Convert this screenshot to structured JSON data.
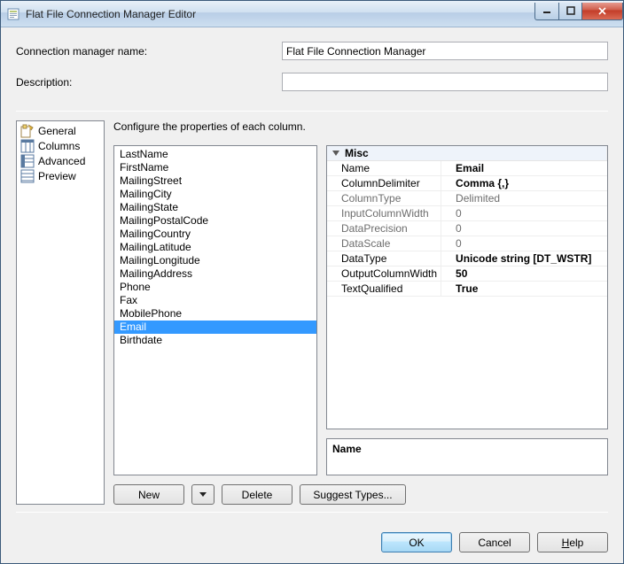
{
  "window": {
    "title": "Flat File Connection Manager Editor"
  },
  "fields": {
    "name_label": "Connection manager name:",
    "name_value": "Flat File Connection Manager",
    "desc_label": "Description:",
    "desc_value": ""
  },
  "nav": {
    "items": [
      {
        "label": "General"
      },
      {
        "label": "Columns"
      },
      {
        "label": "Advanced"
      },
      {
        "label": "Preview"
      }
    ]
  },
  "instruction": "Configure the properties of each column.",
  "columns": [
    "LastName",
    "FirstName",
    "MailingStreet",
    "MailingCity",
    "MailingState",
    "MailingPostalCode",
    "MailingCountry",
    "MailingLatitude",
    "MailingLongitude",
    "MailingAddress",
    "Phone",
    "Fax",
    "MobilePhone",
    "Email",
    "Birthdate"
  ],
  "selected_column_index": 13,
  "properties": {
    "category": "Misc",
    "rows": [
      {
        "key": "Name",
        "value": "Email",
        "bold": true
      },
      {
        "key": "ColumnDelimiter",
        "value": "Comma {,}",
        "bold": true
      },
      {
        "key": "ColumnType",
        "value": "Delimited",
        "dim": true
      },
      {
        "key": "InputColumnWidth",
        "value": "0",
        "dim": true
      },
      {
        "key": "DataPrecision",
        "value": "0",
        "dim": true
      },
      {
        "key": "DataScale",
        "value": "0",
        "dim": true
      },
      {
        "key": "DataType",
        "value": "Unicode string [DT_WSTR]",
        "bold": true
      },
      {
        "key": "OutputColumnWidth",
        "value": "50",
        "bold": true
      },
      {
        "key": "TextQualified",
        "value": "True",
        "bold": true
      }
    ]
  },
  "description_pane": {
    "title": "Name",
    "body": ""
  },
  "buttons": {
    "new": "New",
    "delete": "Delete",
    "suggest": "Suggest Types...",
    "ok": "OK",
    "cancel": "Cancel",
    "help": "Help"
  }
}
